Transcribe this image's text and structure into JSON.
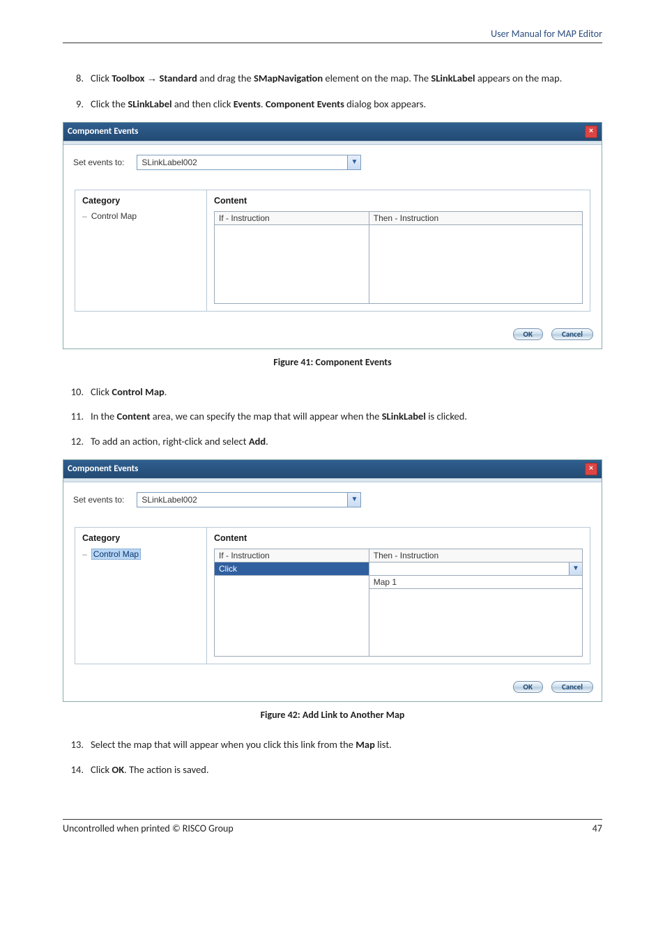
{
  "header": {
    "title": "User Manual for MAP Editor"
  },
  "steps_a": [
    {
      "num": "8.",
      "html": "Click <b>Toolbox</b> <span class='arrow'>→</span> <b>Standard</b> and drag the <b>SMapNavigation</b> element on the map. The <b>SLinkLabel</b> appears on the map."
    },
    {
      "num": "9.",
      "html": "Click the <b>SLinkLabel</b> and then click <b>Events</b>. <b>Component Events</b> dialog box appears."
    }
  ],
  "dialog1": {
    "title": "Component Events",
    "set_events_label": "Set events to:",
    "set_events_value": "SLinkLabel002",
    "category_header": "Category",
    "category_item": "Control Map",
    "content_header": "Content",
    "col_if": "If - Instruction",
    "col_then": "Then - Instruction",
    "ok": "OK",
    "cancel": "Cancel"
  },
  "fig1": "Figure 41: Component Events",
  "steps_b": [
    {
      "num": "10.",
      "html": "Click <b>Control Map</b>."
    },
    {
      "num": "11.",
      "html": "In the <b>Content</b> area, we can specify the map that will appear when the <b>SLinkLabel</b> is clicked."
    },
    {
      "num": "12.",
      "html": "To add an action, right-click and select <b>Add</b>."
    }
  ],
  "dialog2": {
    "title": "Component Events",
    "set_events_label": "Set events to:",
    "set_events_value": "SLinkLabel002",
    "category_header": "Category",
    "category_item": "Control Map",
    "content_header": "Content",
    "col_if": "If - Instruction",
    "col_then": "Then - Instruction",
    "row_if": "Click",
    "row_then": "",
    "map_label": "Map 1",
    "ok": "OK",
    "cancel": "Cancel"
  },
  "fig2": "Figure 42: Add Link to Another Map",
  "steps_c": [
    {
      "num": "13.",
      "html": "Select the map that will appear when you click this link from the <b>Map</b> list."
    },
    {
      "num": "14.",
      "html": "Click <b>OK</b>. The action is saved."
    }
  ],
  "footer": {
    "left": "Uncontrolled when printed © RISCO Group",
    "right": "47"
  }
}
